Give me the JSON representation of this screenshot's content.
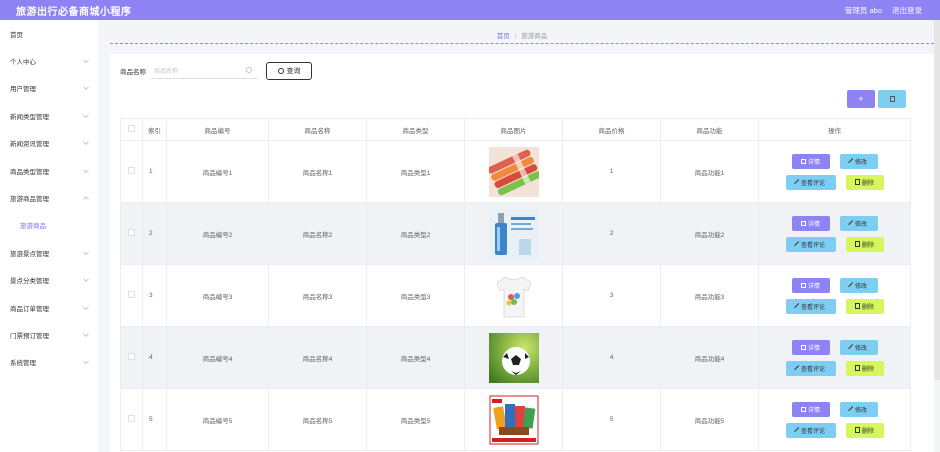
{
  "app": {
    "title": "旅游出行必备商城小程序",
    "admin_label": "管理员 abo",
    "logout_label": "退出登录"
  },
  "sidebar": {
    "items": [
      {
        "label": "首页",
        "chevron": false
      },
      {
        "label": "个人中心",
        "chevron": true
      },
      {
        "label": "用户管理",
        "chevron": true
      },
      {
        "label": "新闻类型管理",
        "chevron": true
      },
      {
        "label": "新闻资讯管理",
        "chevron": true
      },
      {
        "label": "商品类型管理",
        "chevron": true
      },
      {
        "label": "旅游商品管理",
        "chevron": true,
        "expanded": true
      },
      {
        "label": "旅游商品",
        "sub": true
      },
      {
        "label": "旅游景点管理",
        "chevron": true
      },
      {
        "label": "景点分类管理",
        "chevron": true
      },
      {
        "label": "商品订单管理",
        "chevron": true
      },
      {
        "label": "门票预订管理",
        "chevron": true
      },
      {
        "label": "系统管理",
        "chevron": true
      }
    ]
  },
  "breadcrumb": {
    "home": "首页",
    "separator": "/",
    "current": "旅游商品"
  },
  "search": {
    "label": "商品名称",
    "placeholder": "商品名称",
    "button_label": "查询"
  },
  "toolbar": {
    "add_label": "+"
  },
  "table": {
    "headers": [
      "索引",
      "商品编号",
      "商品名称",
      "商品类型",
      "商品图片",
      "商品价格",
      "商品功能",
      "操作"
    ],
    "rows": [
      {
        "index": "1",
        "code": "商品编号1",
        "name": "商品名称1",
        "type": "商品类型1",
        "image": "product-image-lipsticks",
        "price": "1",
        "function": "商品功能1"
      },
      {
        "index": "2",
        "code": "商品编号2",
        "name": "商品名称2",
        "type": "商品类型2",
        "image": "product-image-serum-bottle",
        "price": "2",
        "function": "商品功能2"
      },
      {
        "index": "3",
        "code": "商品编号3",
        "name": "商品名称3",
        "type": "商品类型3",
        "image": "product-image-tshirt",
        "price": "3",
        "function": "商品功能3"
      },
      {
        "index": "4",
        "code": "商品编号4",
        "name": "商品名称4",
        "type": "商品类型4",
        "image": "product-image-soccer-ball",
        "price": "4",
        "function": "商品功能4"
      },
      {
        "index": "5",
        "code": "商品编号5",
        "name": "商品名称5",
        "type": "商品类型5",
        "image": "product-image-snack-pack",
        "price": "5",
        "function": "商品功能5"
      }
    ],
    "actions": {
      "detail": "详情",
      "edit": "修改",
      "review": "查看评论",
      "remove": "删除"
    }
  },
  "colors": {
    "primary": "#8d83f3",
    "info": "#7ecef4",
    "warning": "#d6f75c",
    "row_alt": "#f0f2f6"
  }
}
